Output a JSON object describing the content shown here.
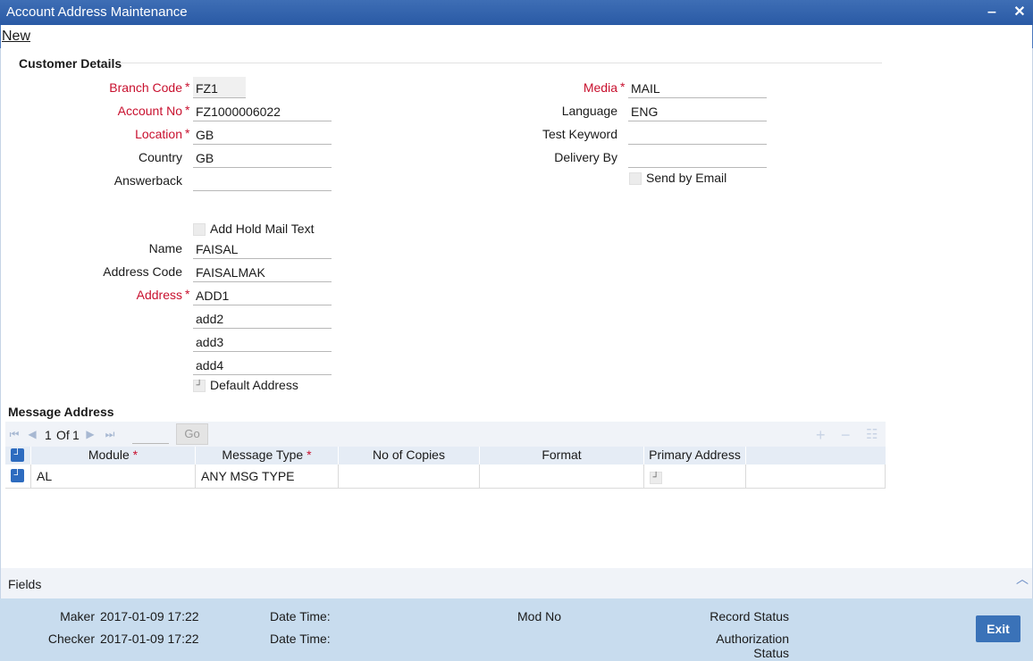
{
  "window": {
    "title": "Account Address Maintenance",
    "minimize_glyph": "‒",
    "close_glyph": "✕"
  },
  "menu": {
    "new_label": "New"
  },
  "customer_details": {
    "section_title": "Customer Details",
    "branch_code": {
      "label": "Branch Code",
      "value": "FZ1"
    },
    "account_no": {
      "label": "Account No",
      "value": "FZ1000006022"
    },
    "location": {
      "label": "Location",
      "value": "GB"
    },
    "country": {
      "label": "Country",
      "value": "GB"
    },
    "answerback": {
      "label": "Answerback",
      "value": ""
    },
    "media": {
      "label": "Media",
      "value": "MAIL"
    },
    "language": {
      "label": "Language",
      "value": "ENG"
    },
    "test_keyword": {
      "label": "Test Keyword",
      "value": ""
    },
    "delivery_by": {
      "label": "Delivery By",
      "value": ""
    },
    "send_by_email": {
      "label": "Send by Email",
      "checked": false
    },
    "add_hold_mail_text": {
      "label": "Add Hold Mail Text",
      "checked": false
    },
    "name": {
      "label": "Name",
      "value": "FAISAL"
    },
    "address_code": {
      "label": "Address Code",
      "value": "FAISALMAK"
    },
    "address": {
      "label": "Address",
      "lines": [
        "ADD1",
        "add2",
        "add3",
        "add4"
      ]
    },
    "default_address": {
      "label": "Default Address",
      "checked": true
    }
  },
  "message_address": {
    "section_title": "Message Address",
    "pagination": {
      "current": "1",
      "of_label": "Of",
      "total": "1",
      "go_label": "Go"
    },
    "columns": [
      "Module",
      "Message Type",
      "No of Copies",
      "Format",
      "Primary Address"
    ],
    "rows": [
      {
        "module": "AL",
        "message_type": "ANY MSG TYPE",
        "copies": "",
        "format": "",
        "primary": true
      }
    ]
  },
  "fields_bar": {
    "label": "Fields"
  },
  "footer": {
    "maker_label": "Maker",
    "maker_value": "2017-01-09 17:22",
    "checker_label": "Checker",
    "checker_value": "2017-01-09 17:22",
    "date_time_label": "Date Time:",
    "mod_no_label": "Mod No",
    "record_status_label": "Record Status",
    "auth_status_label_1": "Authorization",
    "auth_status_label_2": "Status",
    "exit_label": "Exit"
  },
  "colors": {
    "titlebar": "#2f62ae",
    "required": "#c8102e",
    "footer": "#c8dcee",
    "exit_button": "#3a72b8"
  }
}
